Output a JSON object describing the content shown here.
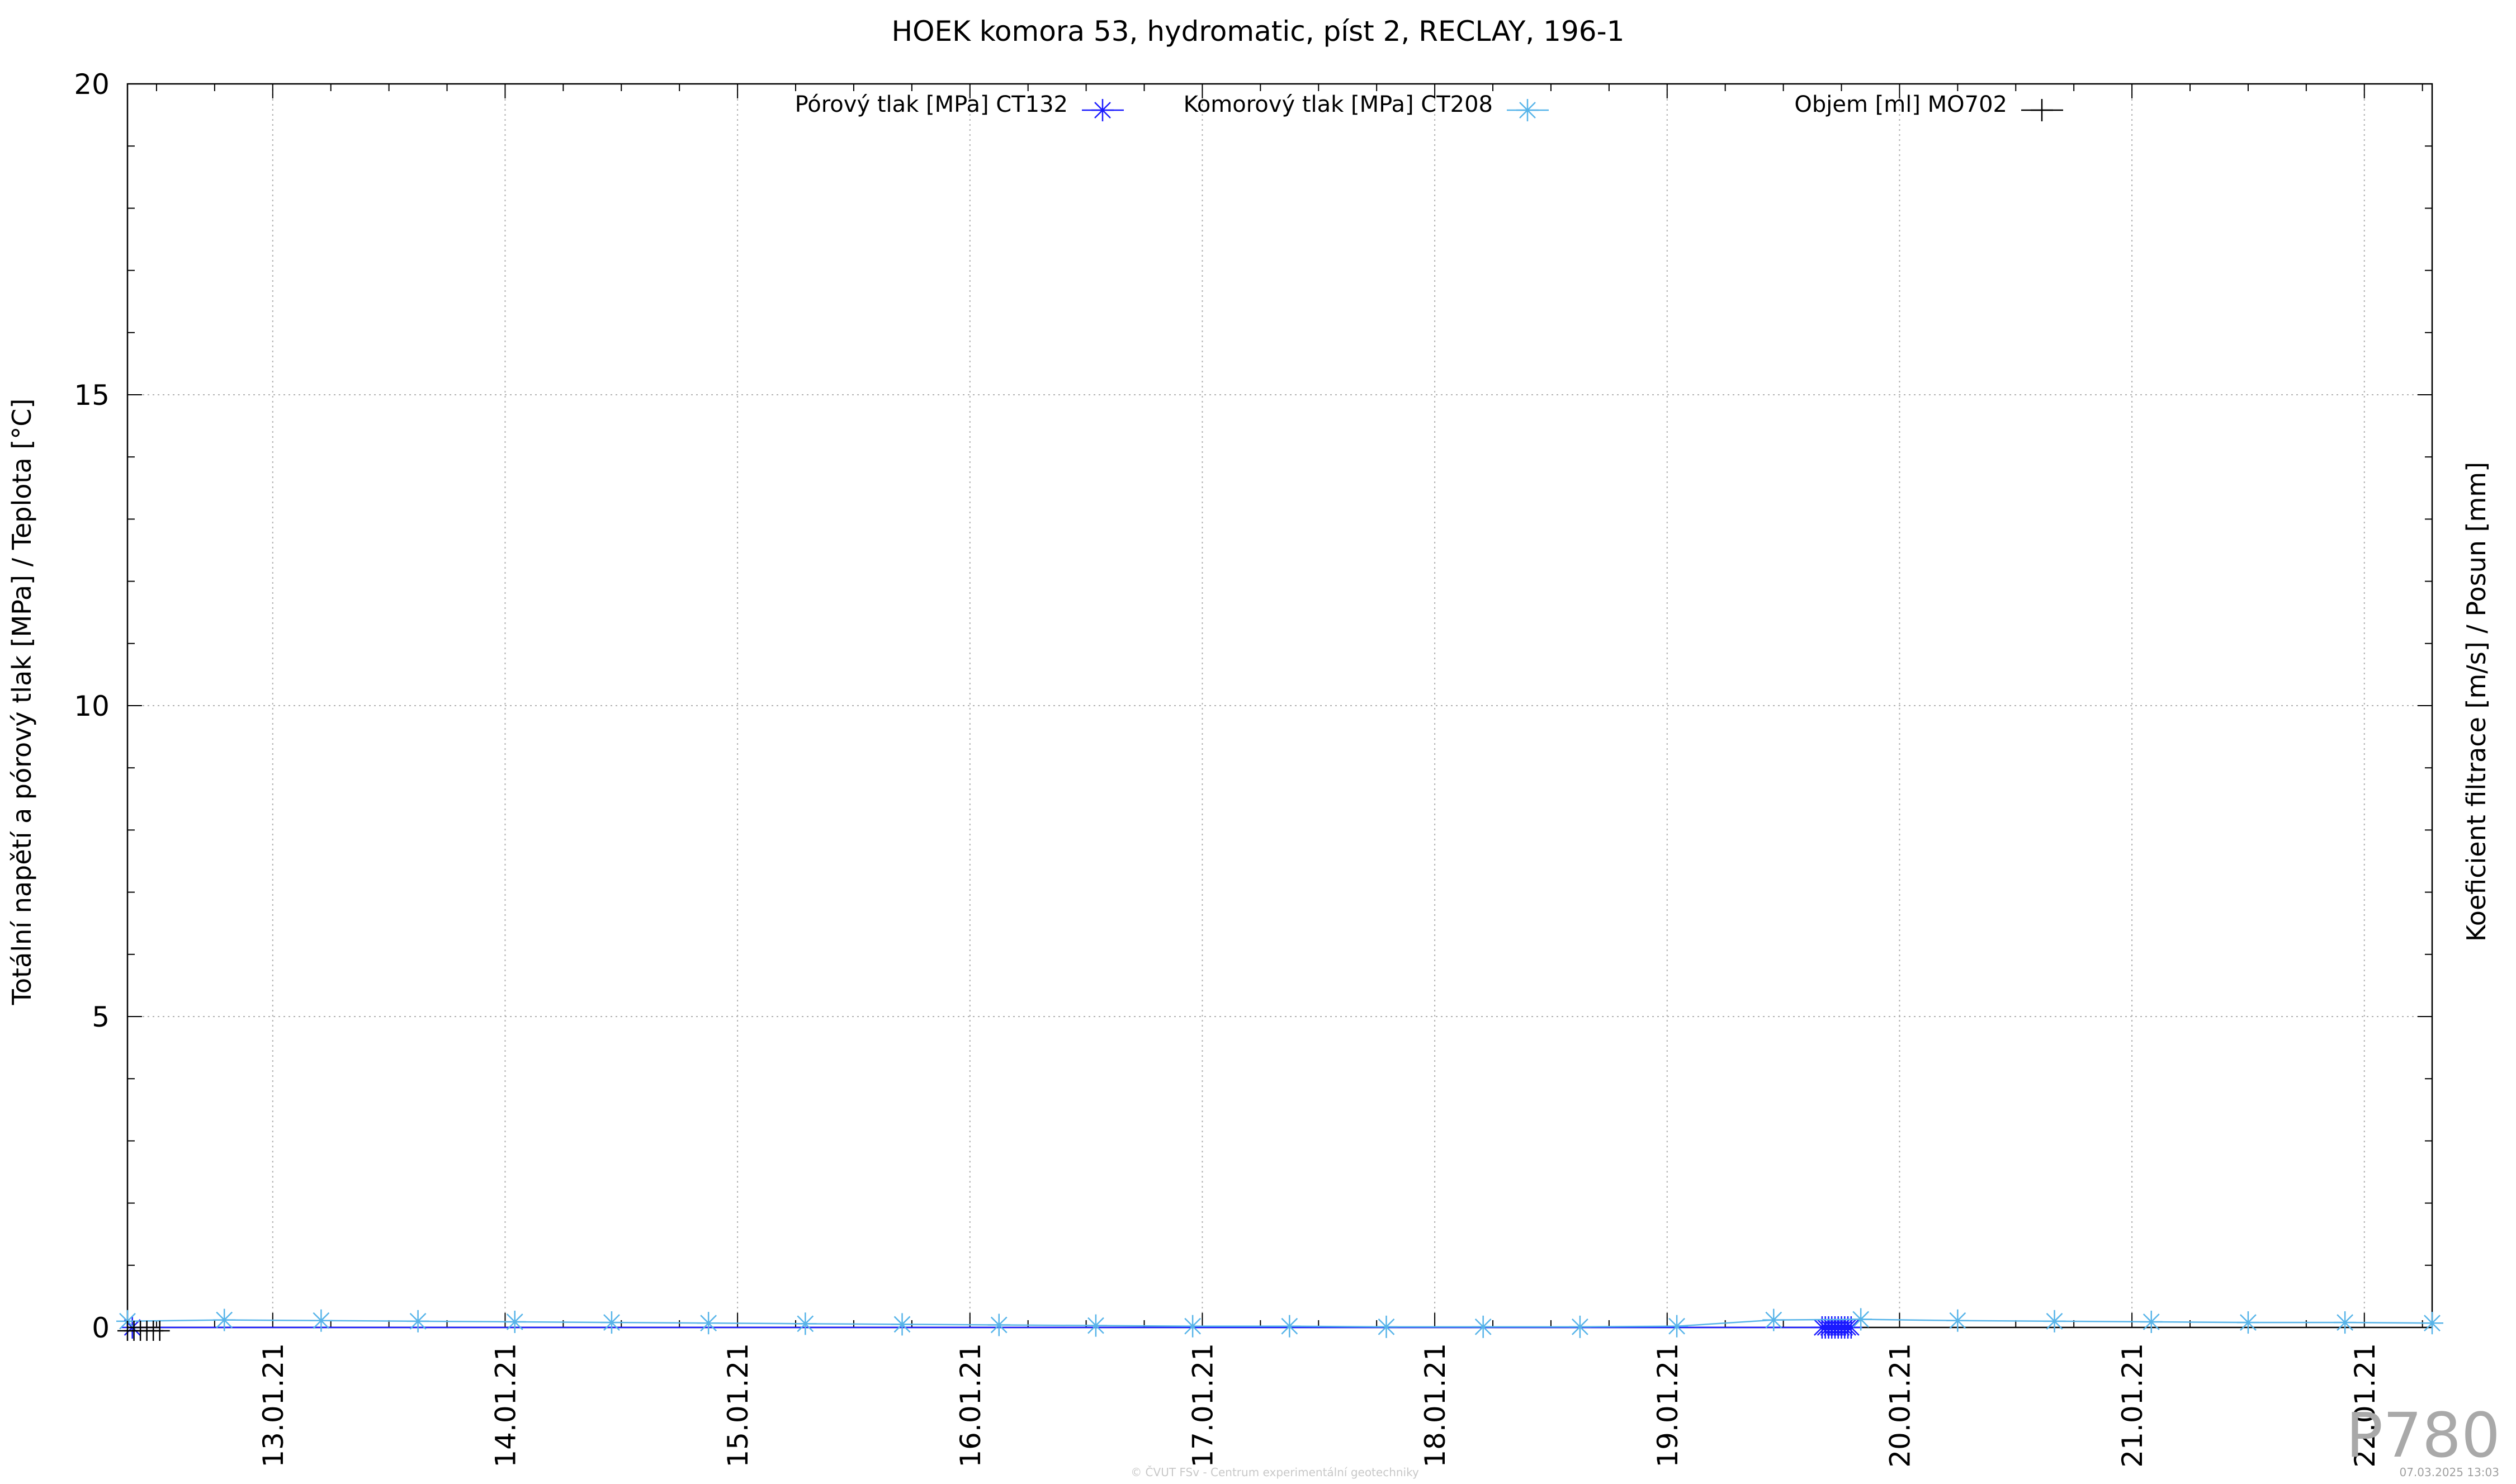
{
  "chart_data": {
    "type": "line",
    "title": "HOEK komora 53, hydromatic, píst 2, RECLAY, 196-1",
    "ylabel": "Totální napětí a pórový tlak [MPa] / Teplota [°C]",
    "y2label": "Koeficient filtrace [m/s] / Posun [mm]",
    "xlabel": "",
    "x_start": "12.01.21 09:00",
    "x_end": "22.01.21 07:00",
    "ylim": [
      0,
      20
    ],
    "yticks": [
      0,
      5,
      10,
      15,
      20
    ],
    "xticks": [
      "13.01.21",
      "14.01.21",
      "15.01.21",
      "16.01.21",
      "17.01.21",
      "18.01.21",
      "19.01.21",
      "20.01.21",
      "21.01.21",
      "22.01.21"
    ],
    "grid": true,
    "legend_position": "top",
    "series": [
      {
        "name": "Pórový tlak [MPa] CT132",
        "color": "#1a1aff",
        "marker": "asterisk",
        "x": [
          "12.01.21 09:30",
          "19.01.21 16:00",
          "19.01.21 16:20",
          "19.01.21 16:40",
          "19.01.21 17:00",
          "19.01.21 17:20",
          "19.01.21 17:40",
          "19.01.21 18:00",
          "19.01.21 18:20",
          "19.01.21 18:40",
          "19.01.21 19:00"
        ],
        "y": [
          0.0,
          0.0,
          0.0,
          0.0,
          0.0,
          0.0,
          0.0,
          0.0,
          0.0,
          0.0,
          0.0
        ]
      },
      {
        "name": "Komorový tlak [MPa] CT208",
        "color": "#57b4e9",
        "marker": "asterisk",
        "x": [
          "12.01.21 09:00",
          "12.01.21 19:00",
          "13.01.21 05:00",
          "13.01.21 15:00",
          "14.01.21 01:00",
          "14.01.21 11:00",
          "14.01.21 21:00",
          "15.01.21 07:00",
          "15.01.21 17:00",
          "16.01.21 03:00",
          "16.01.21 13:00",
          "16.01.21 23:00",
          "17.01.21 09:00",
          "17.01.21 19:00",
          "18.01.21 05:00",
          "18.01.21 15:00",
          "19.01.21 01:00",
          "19.01.21 11:00",
          "19.01.21 20:00",
          "20.01.21 06:00",
          "20.01.21 16:00",
          "21.01.21 02:00",
          "21.01.21 12:00",
          "21.01.21 22:00",
          "22.01.21 07:00"
        ],
        "y": [
          0.1,
          0.12,
          0.11,
          0.1,
          0.09,
          0.08,
          0.07,
          0.06,
          0.05,
          0.04,
          0.03,
          0.02,
          0.02,
          0.01,
          0.01,
          0.01,
          0.02,
          0.12,
          0.13,
          0.11,
          0.1,
          0.09,
          0.08,
          0.08,
          0.07
        ]
      },
      {
        "name": "Objem [ml] MO702",
        "color": "#000000",
        "marker": "plus",
        "x": [
          "12.01.21 09:00",
          "12.01.21 09:40",
          "12.01.21 10:20",
          "12.01.21 11:00",
          "12.01.21 11:40",
          "12.01.21 12:20"
        ],
        "y": [
          0.0,
          0.0,
          0.0,
          0.0,
          0.0,
          0.0
        ]
      }
    ]
  },
  "watermark": {
    "label": "P780",
    "footer": "© ČVUT FSv - Centrum experimentální geotechniky",
    "stamp": "07.03.2025 13:03"
  }
}
